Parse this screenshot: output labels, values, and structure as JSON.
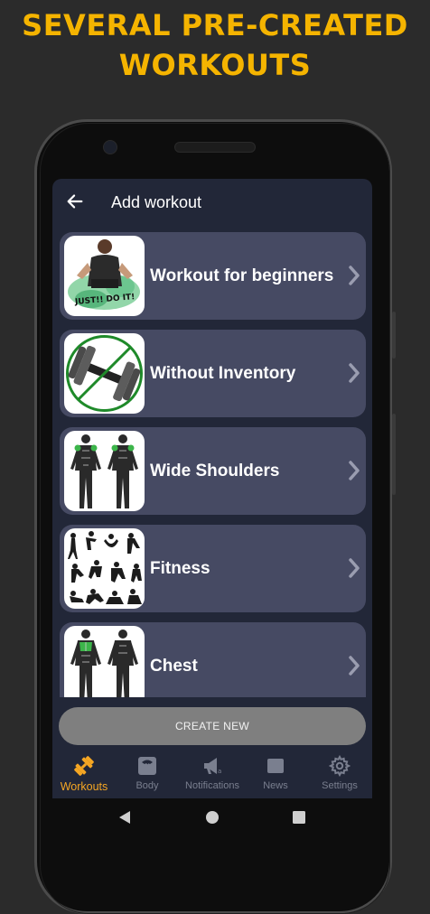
{
  "promo": {
    "line1": "SEVERAL PRE-CREATED",
    "line2": "WORKOUTS"
  },
  "colors": {
    "accent": "#f5b400",
    "screen_bg": "#222738",
    "card_bg": "#464a63",
    "button_bg": "#7f7f7f",
    "active_nav": "#f5a623"
  },
  "header": {
    "title": "Add workout",
    "back_icon": "arrow-left-icon"
  },
  "workouts": [
    {
      "label": "Workout for beginners",
      "thumb": "just-do-it-image",
      "thumb_caption": "JUST!! DO IT!"
    },
    {
      "label": "Without Inventory",
      "thumb": "crossed-dumbbell-image"
    },
    {
      "label": "Wide Shoulders",
      "thumb": "shoulders-anatomy-image"
    },
    {
      "label": "Fitness",
      "thumb": "fitness-silhouettes-image"
    },
    {
      "label": "Chest",
      "thumb": "chest-anatomy-image"
    }
  ],
  "create_button": "CREATE NEW",
  "nav": [
    {
      "label": "Workouts",
      "icon": "dumbbell-icon",
      "active": true
    },
    {
      "label": "Body",
      "icon": "scale-icon",
      "active": false
    },
    {
      "label": "Notifications",
      "icon": "megaphone-icon",
      "active": false
    },
    {
      "label": "News",
      "icon": "news-icon",
      "active": false
    },
    {
      "label": "Settings",
      "icon": "gear-icon",
      "active": false
    }
  ]
}
